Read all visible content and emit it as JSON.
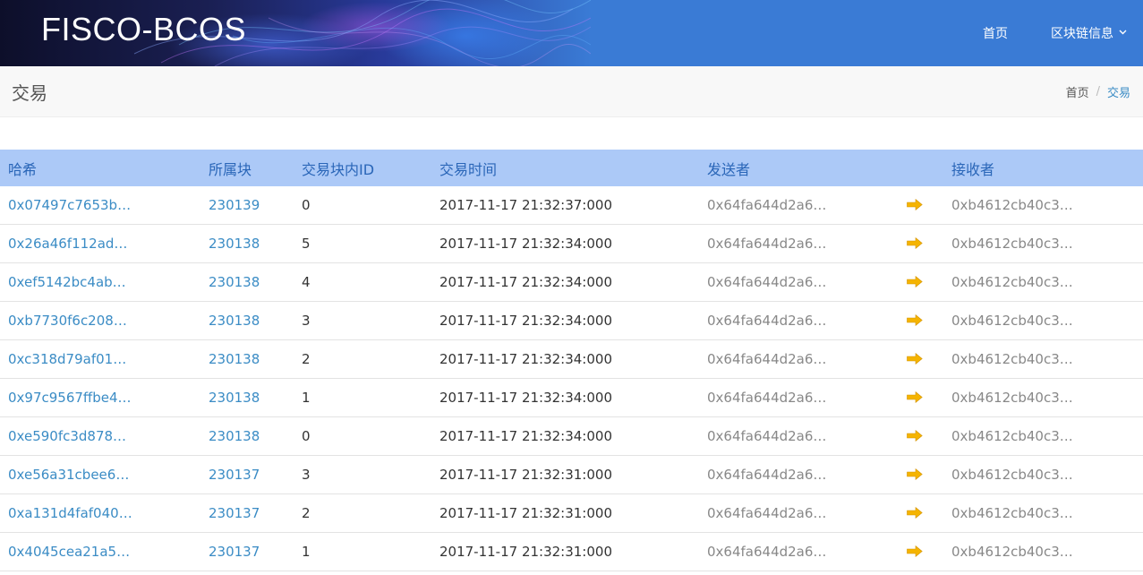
{
  "brand": "FISCO-BCOS",
  "nav": {
    "home_label": "首页",
    "blockchain_info_label": "区块链信息"
  },
  "page": {
    "title": "交易",
    "breadcrumb": {
      "home": "首页",
      "separator": "/",
      "current": "交易"
    }
  },
  "colors": {
    "nav_bg": "#3a7bd5",
    "table_header_bg": "#acc9f7",
    "link": "#3b8cc5",
    "arrow": "#f5b400"
  },
  "table": {
    "headers": [
      "哈希",
      "所属块",
      "交易块内ID",
      "交易时间",
      "发送者",
      "",
      "接收者"
    ],
    "rows": [
      {
        "hash": "0x07497c7653b…",
        "block": "230139",
        "index": "0",
        "time": "2017-11-17 21:32:37:000",
        "from": "0x64fa644d2a6…",
        "to": "0xb4612cb40c3…"
      },
      {
        "hash": "0x26a46f112ad…",
        "block": "230138",
        "index": "5",
        "time": "2017-11-17 21:32:34:000",
        "from": "0x64fa644d2a6…",
        "to": "0xb4612cb40c3…"
      },
      {
        "hash": "0xef5142bc4ab…",
        "block": "230138",
        "index": "4",
        "time": "2017-11-17 21:32:34:000",
        "from": "0x64fa644d2a6…",
        "to": "0xb4612cb40c3…"
      },
      {
        "hash": "0xb7730f6c208…",
        "block": "230138",
        "index": "3",
        "time": "2017-11-17 21:32:34:000",
        "from": "0x64fa644d2a6…",
        "to": "0xb4612cb40c3…"
      },
      {
        "hash": "0xc318d79af01…",
        "block": "230138",
        "index": "2",
        "time": "2017-11-17 21:32:34:000",
        "from": "0x64fa644d2a6…",
        "to": "0xb4612cb40c3…"
      },
      {
        "hash": "0x97c9567ffbe4…",
        "block": "230138",
        "index": "1",
        "time": "2017-11-17 21:32:34:000",
        "from": "0x64fa644d2a6…",
        "to": "0xb4612cb40c3…"
      },
      {
        "hash": "0xe590fc3d878…",
        "block": "230138",
        "index": "0",
        "time": "2017-11-17 21:32:34:000",
        "from": "0x64fa644d2a6…",
        "to": "0xb4612cb40c3…"
      },
      {
        "hash": "0xe56a31cbee6…",
        "block": "230137",
        "index": "3",
        "time": "2017-11-17 21:32:31:000",
        "from": "0x64fa644d2a6…",
        "to": "0xb4612cb40c3…"
      },
      {
        "hash": "0xa131d4faf040…",
        "block": "230137",
        "index": "2",
        "time": "2017-11-17 21:32:31:000",
        "from": "0x64fa644d2a6…",
        "to": "0xb4612cb40c3…"
      },
      {
        "hash": "0x4045cea21a5…",
        "block": "230137",
        "index": "1",
        "time": "2017-11-17 21:32:31:000",
        "from": "0x64fa644d2a6…",
        "to": "0xb4612cb40c3…"
      }
    ]
  }
}
